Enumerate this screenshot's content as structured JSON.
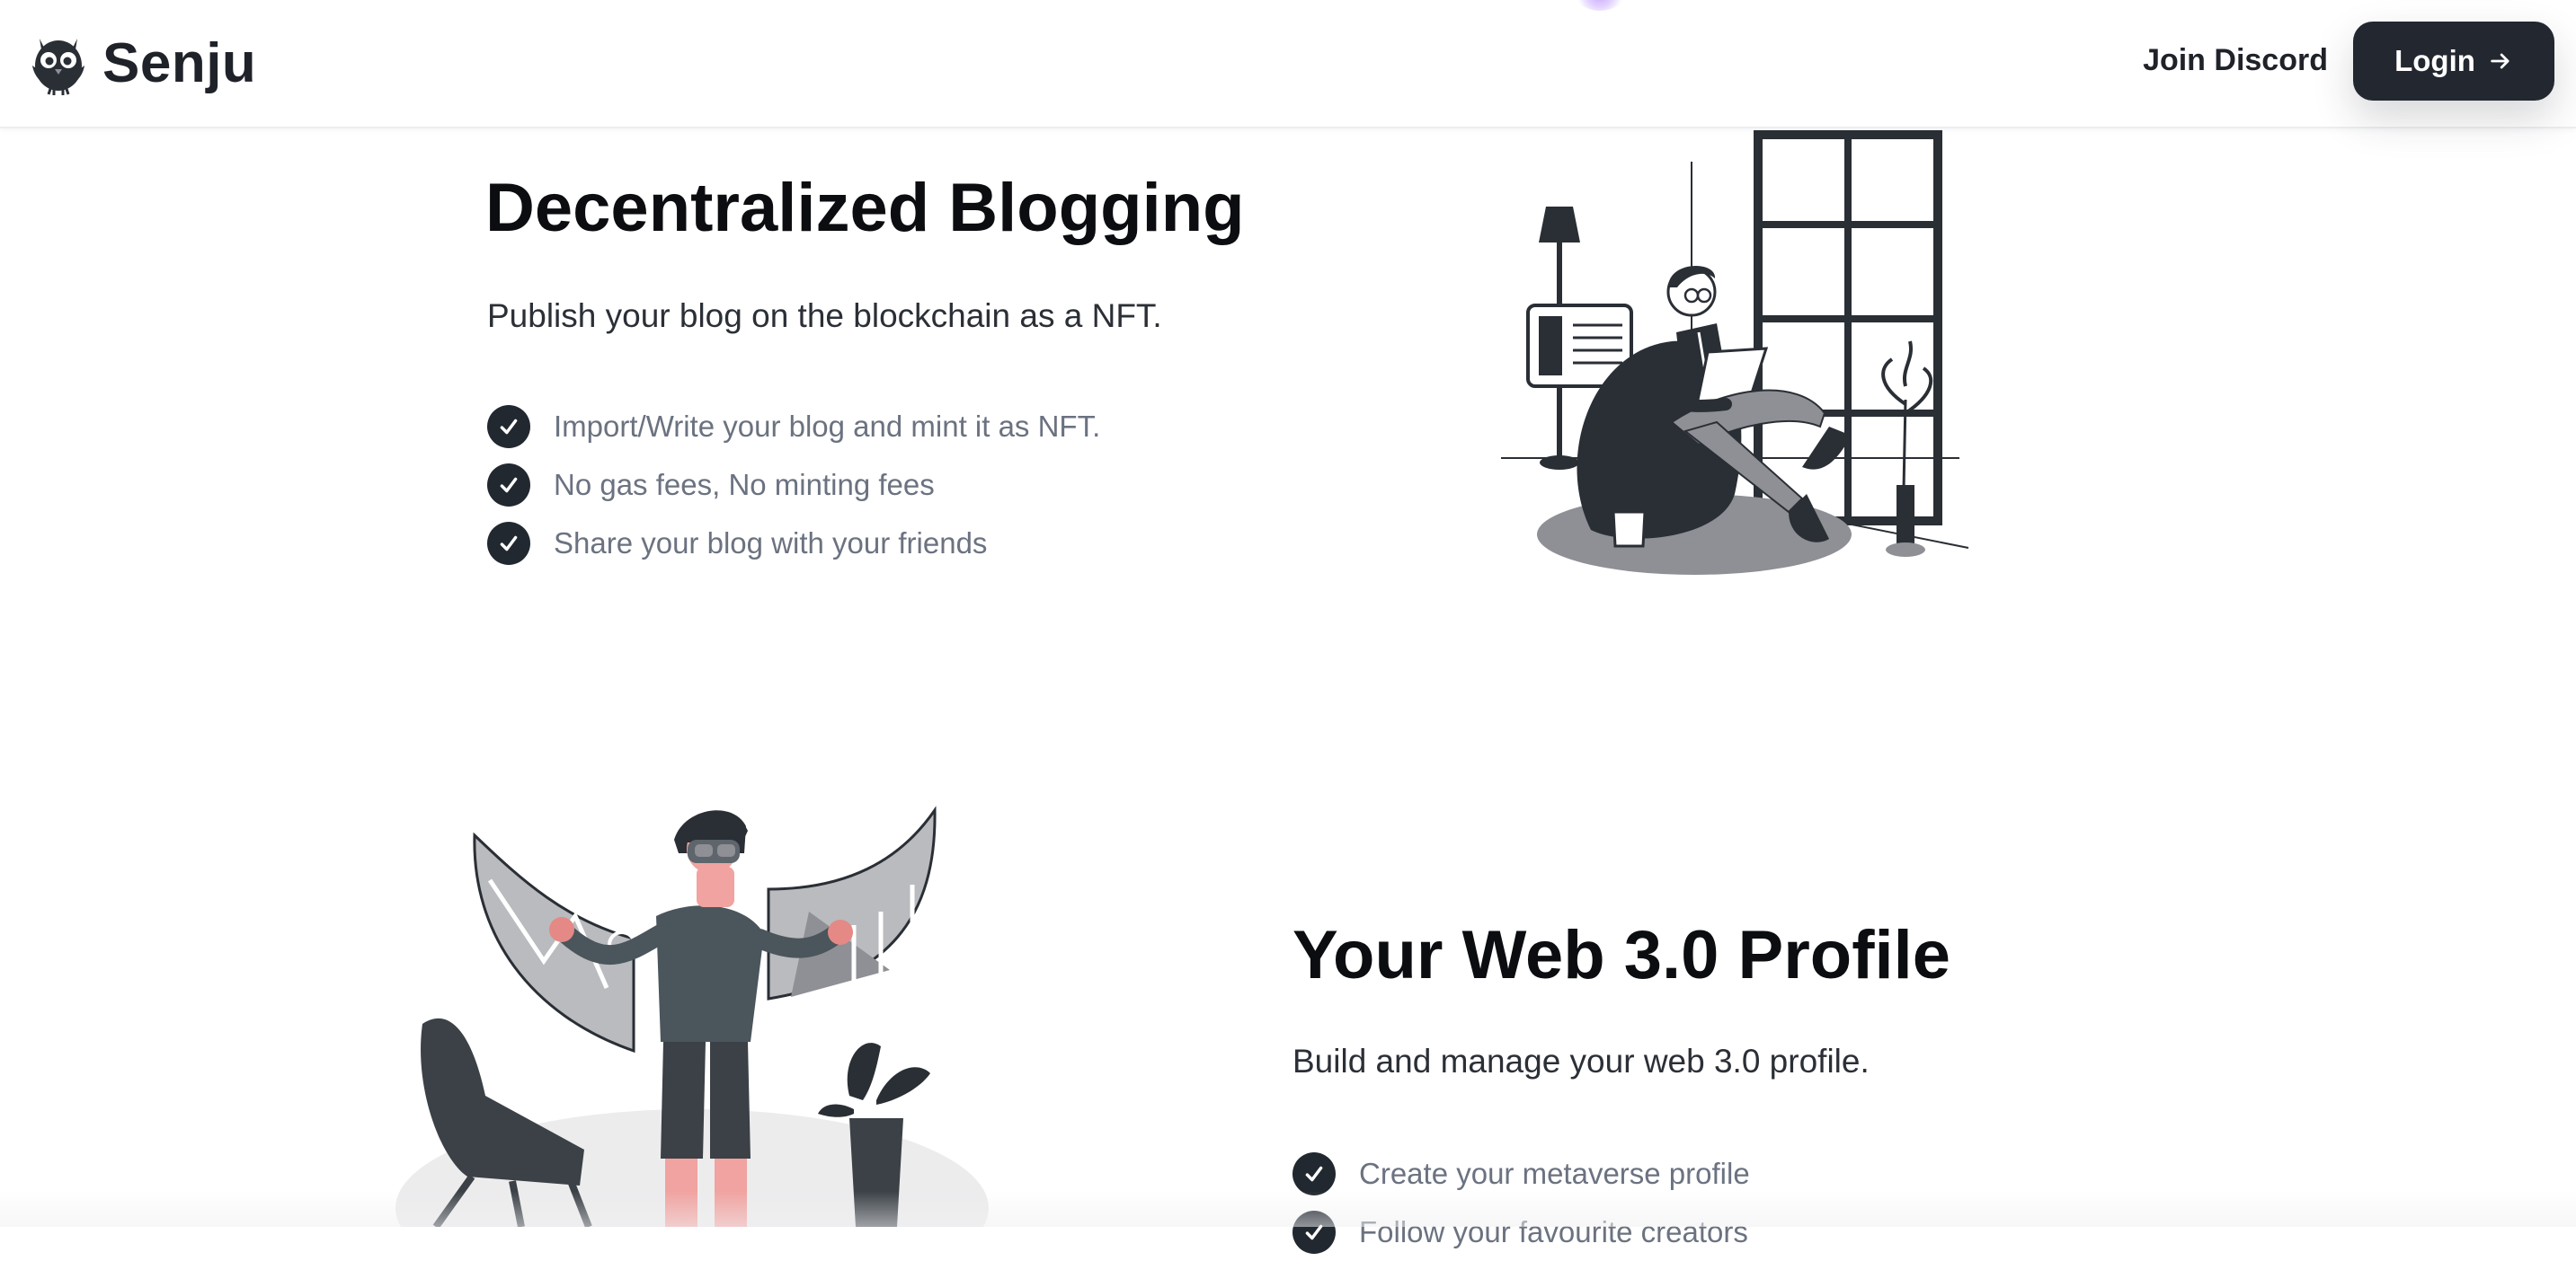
{
  "header": {
    "brand_name": "Senju",
    "logo_icon": "owl-logo-icon",
    "join_discord_label": "Join Discord",
    "login_label": "Login",
    "login_icon": "arrow-right-icon",
    "accent_color": "#232730"
  },
  "sections": [
    {
      "title": "Decentralized Blogging",
      "subtitle": "Publish your blog on the blockchain as a NFT.",
      "features": [
        "Import/Write your blog and mint it as NFT.",
        "No gas fees, No minting fees",
        "Share your blog with your friends"
      ],
      "illustration": "man-reading-in-beanbag-illustration"
    },
    {
      "title": "Your Web 3.0 Profile",
      "subtitle": "Build and manage your web 3.0 profile.",
      "features": [
        "Create your metaverse profile",
        "Follow your favourite creators"
      ],
      "illustration": "vr-headset-user-illustration"
    }
  ],
  "colors": {
    "check_badge": "#222830",
    "feature_text": "#6b7280",
    "title_text": "#0b0d10"
  }
}
